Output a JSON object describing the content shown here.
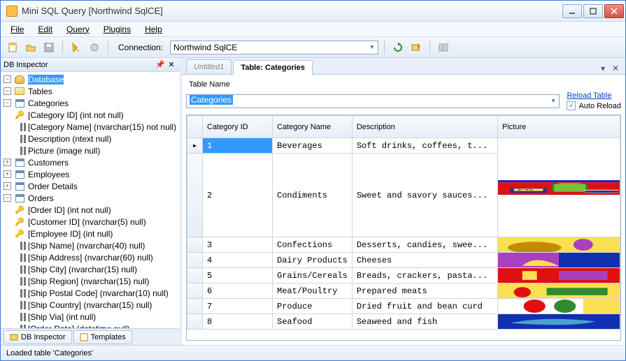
{
  "window": {
    "title": "Mini SQL Query [Northwind SqlCE]"
  },
  "menu": {
    "file": "File",
    "edit": "Edit",
    "query": "Query",
    "plugins": "Plugins",
    "help": "Help"
  },
  "toolbar": {
    "connection_label": "Connection:",
    "connection_value": "Northwind SqlCE"
  },
  "dbinspector": {
    "title": "DB Inspector",
    "root": "Database",
    "tables_label": "Tables",
    "categories": {
      "name": "Categories",
      "cols": [
        "[Category ID]  (int not null)",
        "[Category Name]  (nvarchar(15) not null)",
        "Description  (ntext null)",
        "Picture  (image null)"
      ]
    },
    "simple_tables": [
      "Customers",
      "Employees",
      "Order Details"
    ],
    "orders": {
      "name": "Orders",
      "cols": [
        "[Order ID]  (int not null)",
        "[Customer ID]  (nvarchar(5) null)",
        "[Employee ID]  (int null)",
        "[Ship Name]  (nvarchar(40) null)",
        "[Ship Address]  (nvarchar(60) null)",
        "[Ship City]  (nvarchar(15) null)",
        "[Ship Region]  (nvarchar(15) null)",
        "[Ship Postal Code]  (nvarchar(10) null)",
        "[Ship Country]  (nvarchar(15) null)",
        "[Ship Via]  (int null)",
        "[Order Date]  (datetime null)"
      ],
      "keyflags": [
        true,
        true,
        true,
        false,
        false,
        false,
        false,
        false,
        false,
        false,
        false
      ]
    }
  },
  "bottomtabs": {
    "dbi": "DB Inspector",
    "tpl": "Templates"
  },
  "doctabs": {
    "untitled": "Untitled1",
    "table": "Table: Categories"
  },
  "tablepanel": {
    "label": "Table Name",
    "value": "Categories",
    "reload": "Reload Table",
    "auto": "Auto Reload",
    "headers": {
      "rowhdr": "",
      "c1": "Category ID",
      "c2": "Category Name",
      "c3": "Description",
      "c4": "Picture"
    },
    "rows": [
      {
        "id": "1",
        "name": "Beverages",
        "desc": "Soft drinks, coffees, t..."
      },
      {
        "id": "2",
        "name": "Condiments",
        "desc": "Sweet and savory sauces..."
      },
      {
        "id": "3",
        "name": "Confections",
        "desc": "Desserts, candies, swee..."
      },
      {
        "id": "4",
        "name": "Dairy Products",
        "desc": "Cheeses"
      },
      {
        "id": "5",
        "name": "Grains/Cereals",
        "desc": "Breads, crackers, pasta..."
      },
      {
        "id": "6",
        "name": "Meat/Poultry",
        "desc": "Prepared meats"
      },
      {
        "id": "7",
        "name": "Produce",
        "desc": "Dried fruit and bean curd"
      },
      {
        "id": "8",
        "name": "Seafood",
        "desc": "Seaweed and fish"
      }
    ]
  },
  "status": "Loaded table 'Categories'"
}
